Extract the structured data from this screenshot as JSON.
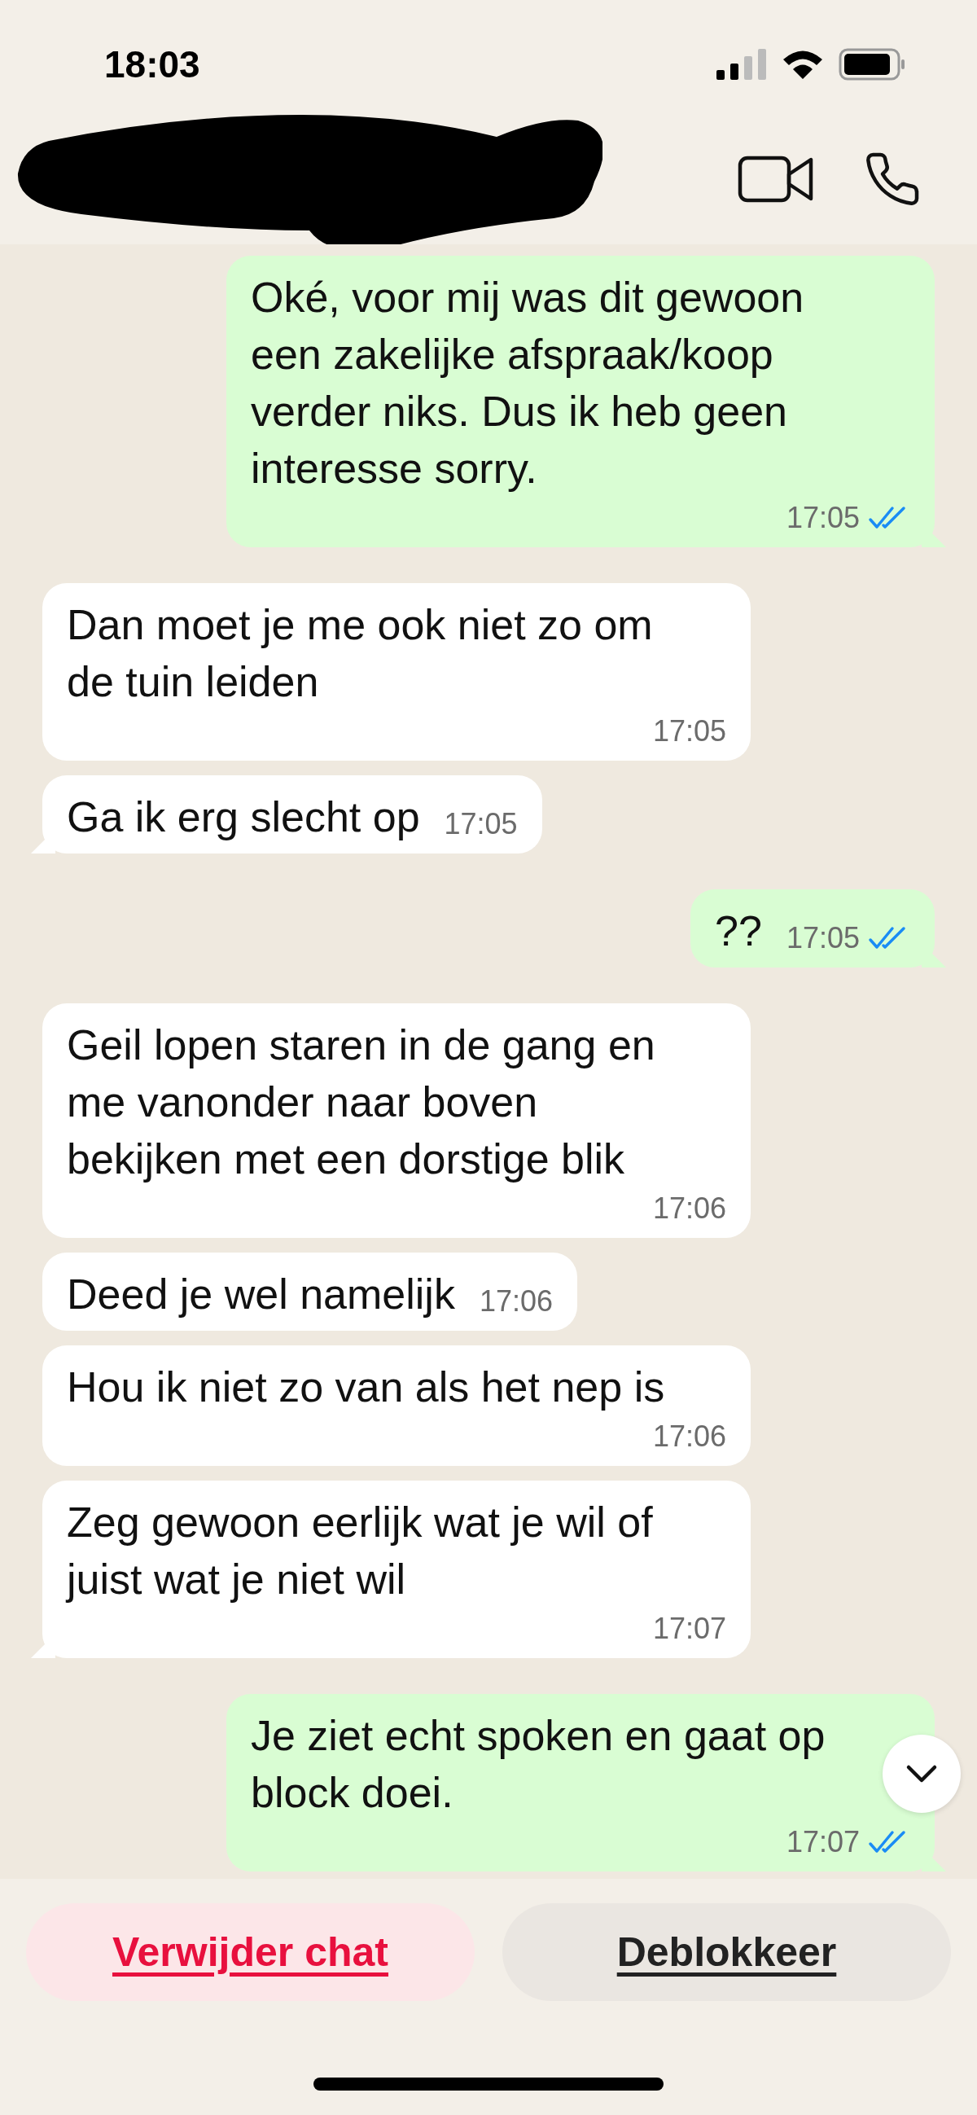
{
  "status_bar": {
    "time": "18:03"
  },
  "messages": [
    {
      "kind": "sent",
      "text": "Oké, voor mij was dit gewoon een zakelijke afspraak/koop verder niks. Dus ik heb geen interesse sorry.",
      "time": "17:05",
      "tail": true,
      "read": true
    },
    {
      "kind": "received",
      "text": "Dan moet je me ook niet zo om de tuin leiden",
      "time": "17:05",
      "tail": false
    },
    {
      "kind": "received",
      "text": "Ga ik erg slecht op",
      "time": "17:05",
      "tail": true
    },
    {
      "kind": "sent",
      "text": "??",
      "time": "17:05",
      "tail": true,
      "read": true
    },
    {
      "kind": "received",
      "text": "Geil lopen staren in de gang en me vanonder naar boven bekijken met een dorstige blik",
      "time": "17:06",
      "tail": false
    },
    {
      "kind": "received",
      "text": "Deed je wel namelijk",
      "time": "17:06",
      "tail": false
    },
    {
      "kind": "received",
      "text": "Hou ik niet zo van als het nep is",
      "time": "17:06",
      "tail": false
    },
    {
      "kind": "received",
      "text": "Zeg gewoon eerlijk wat je wil of juist wat je niet wil",
      "time": "17:07",
      "tail": true
    },
    {
      "kind": "sent",
      "text": "Je ziet echt spoken en gaat op block doei.",
      "time": "17:07",
      "tail": true,
      "read": true
    }
  ],
  "actions": [
    {
      "label": "Verwijder chat",
      "kind": "danger"
    },
    {
      "label": "Deblokkeer",
      "kind": "neutral"
    }
  ]
}
